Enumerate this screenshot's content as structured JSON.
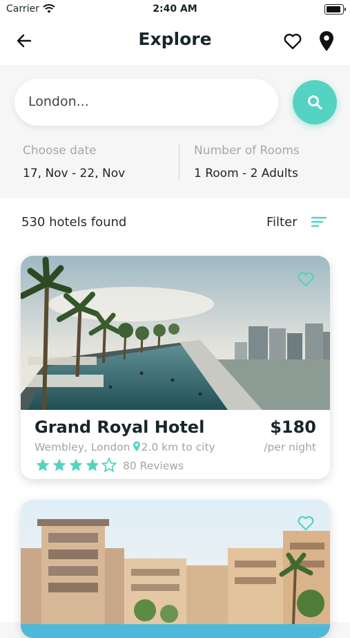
{
  "status_bar": {
    "carrier": "Carrier",
    "time": "2:40 AM"
  },
  "header": {
    "title": "Explore"
  },
  "search": {
    "placeholder": "London..."
  },
  "booking": {
    "date_label": "Choose date",
    "date_value": "17, Nov - 22, Nov",
    "rooms_label": "Number of Rooms",
    "rooms_value": "1 Room - 2 Adults"
  },
  "results": {
    "count_text": "530 hotels found",
    "filter_label": "Filter"
  },
  "hotels": [
    {
      "name": "Grand Royal Hotel",
      "location": "Wembley, London",
      "distance": "2.0 km to city",
      "price": "$180",
      "per": "/per night",
      "rating": 4.5,
      "reviews": "80 Reviews"
    },
    {}
  ],
  "colors": {
    "accent": "#54d3c2",
    "text_dark": "#17262a",
    "text_muted": "#a3a3a3"
  },
  "icons": [
    "back-arrow-icon",
    "heart-outline-icon",
    "map-pin-icon",
    "search-icon",
    "filter-icon",
    "star-icon"
  ]
}
